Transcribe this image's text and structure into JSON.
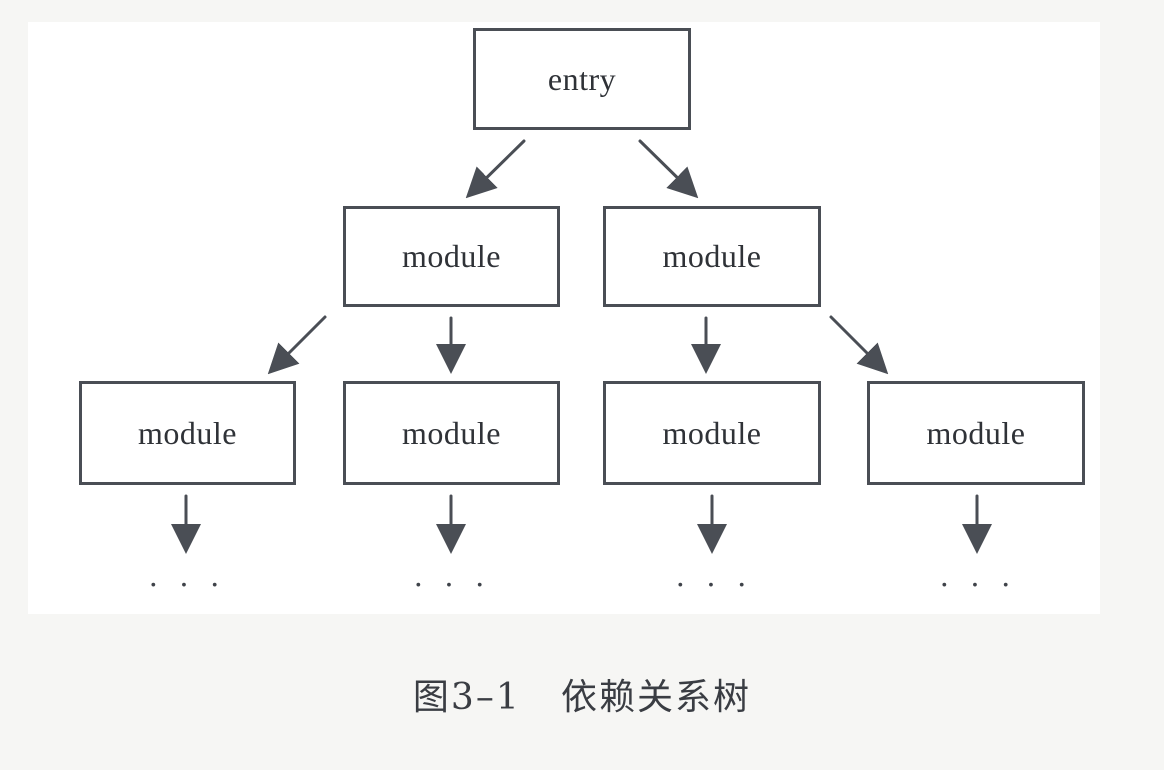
{
  "diagram": {
    "entry_label": "entry",
    "modules_level1": [
      "module",
      "module"
    ],
    "modules_level2": [
      "module",
      "module",
      "module",
      "module"
    ],
    "continuation": "· · ·"
  },
  "caption": "图3–1   依赖关系树",
  "colors": {
    "stroke": "#4a4e55",
    "panel": "#ffffff",
    "background": "#f6f6f4"
  }
}
